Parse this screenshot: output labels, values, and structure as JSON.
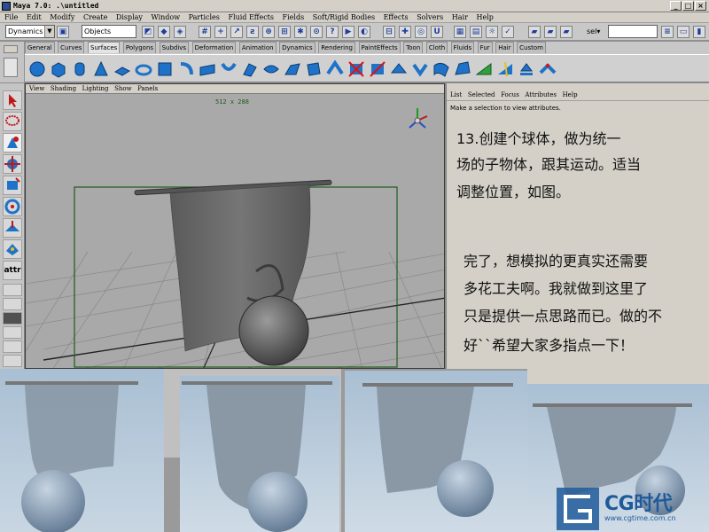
{
  "window": {
    "title": "Maya 7.0: .\\untitled"
  },
  "menubar": [
    "File",
    "Edit",
    "Modify",
    "Create",
    "Display",
    "Window",
    "Particles",
    "Fluid Effects",
    "Fields",
    "Soft/Rigid Bodies",
    "Effects",
    "Solvers",
    "Hair",
    "Help"
  ],
  "statusline": {
    "menuset": "Dynamics",
    "selection_mode": "Objects",
    "sel_label": "sel▾"
  },
  "shelf_tabs": [
    "General",
    "Curves",
    "Surfaces",
    "Polygons",
    "Subdivs",
    "Deformation",
    "Animation",
    "Dynamics",
    "Rendering",
    "PaintEffects",
    "Toon",
    "Cloth",
    "Fluids",
    "Fur",
    "Hair",
    "Custom"
  ],
  "active_shelf_tab": "Surfaces",
  "viewport": {
    "menu": [
      "View",
      "Shading",
      "Lighting",
      "Show",
      "Panels"
    ],
    "resolution": "512 x 288"
  },
  "attribute_editor": {
    "menu": [
      "List",
      "Selected",
      "Focus",
      "Attributes",
      "Help"
    ],
    "hint": "Make a selection to view attributes."
  },
  "tutorial": {
    "step": [
      "13.创建个球体，做为统一",
      "场的子物体，跟其运动。适当",
      "调整位置，如图。"
    ],
    "closing": [
      "完了，想模拟的更真实还需要",
      "多花工夫啊。我就做到这里了",
      "只是提供一点思路而已。做的不",
      "好``希望大家多指点一下！"
    ]
  },
  "watermark": {
    "brand": "CG时代",
    "url": "www.cgtime.com.cn"
  },
  "colors": {
    "maya_gray": "#d4d0c8",
    "viewport_bg": "#a9a9a9",
    "render_sky": "#a8bcd0",
    "brand_blue": "#1e5a9a"
  }
}
